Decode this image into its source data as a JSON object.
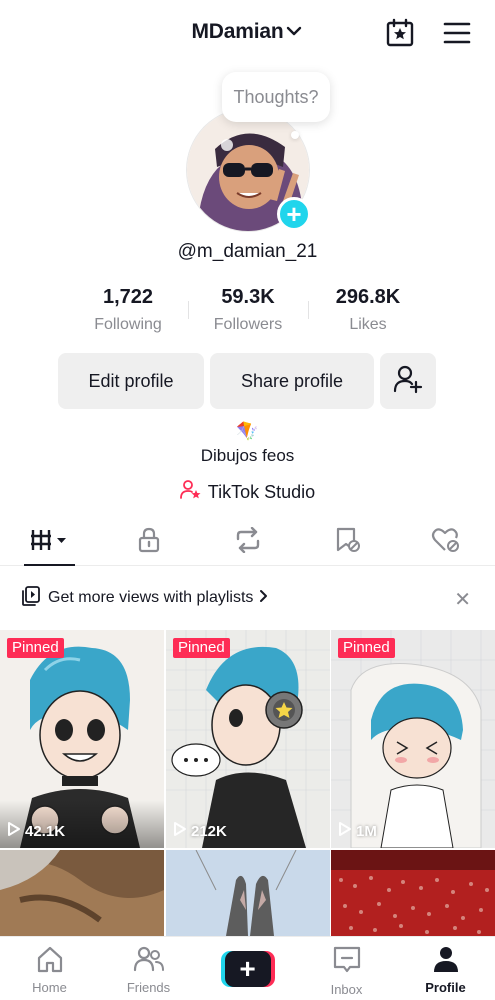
{
  "header": {
    "username": "MDamian",
    "calendar_icon": "calendar-star-icon",
    "menu_icon": "hamburger-menu-icon"
  },
  "profile": {
    "thought_placeholder": "Thoughts?",
    "handle": "@m_damian_21",
    "stats": [
      {
        "value": "1,722",
        "label": "Following"
      },
      {
        "value": "59.3K",
        "label": "Followers"
      },
      {
        "value": "296.8K",
        "label": "Likes"
      }
    ],
    "buttons": {
      "edit": "Edit profile",
      "share": "Share profile"
    },
    "bio_emoji": "🪁",
    "bio": "Dibujos feos",
    "studio_link": "TikTok Studio"
  },
  "tabs": [
    "videos-grid-icon",
    "lock-icon",
    "repost-icon",
    "saved-icon",
    "liked-icon"
  ],
  "promo": {
    "text": "Get more views with playlists"
  },
  "videos": [
    {
      "pinned_label": "Pinned",
      "views": "42.1K"
    },
    {
      "pinned_label": "Pinned",
      "views": "212K"
    },
    {
      "pinned_label": "Pinned",
      "views": "1M"
    }
  ],
  "nav": {
    "home": "Home",
    "friends": "Friends",
    "inbox": "Inbox",
    "profile": "Profile"
  },
  "colors": {
    "accent": "#fe2c55",
    "cyan": "#20d5ec",
    "text": "#161823",
    "muted": "#8a8b91"
  }
}
